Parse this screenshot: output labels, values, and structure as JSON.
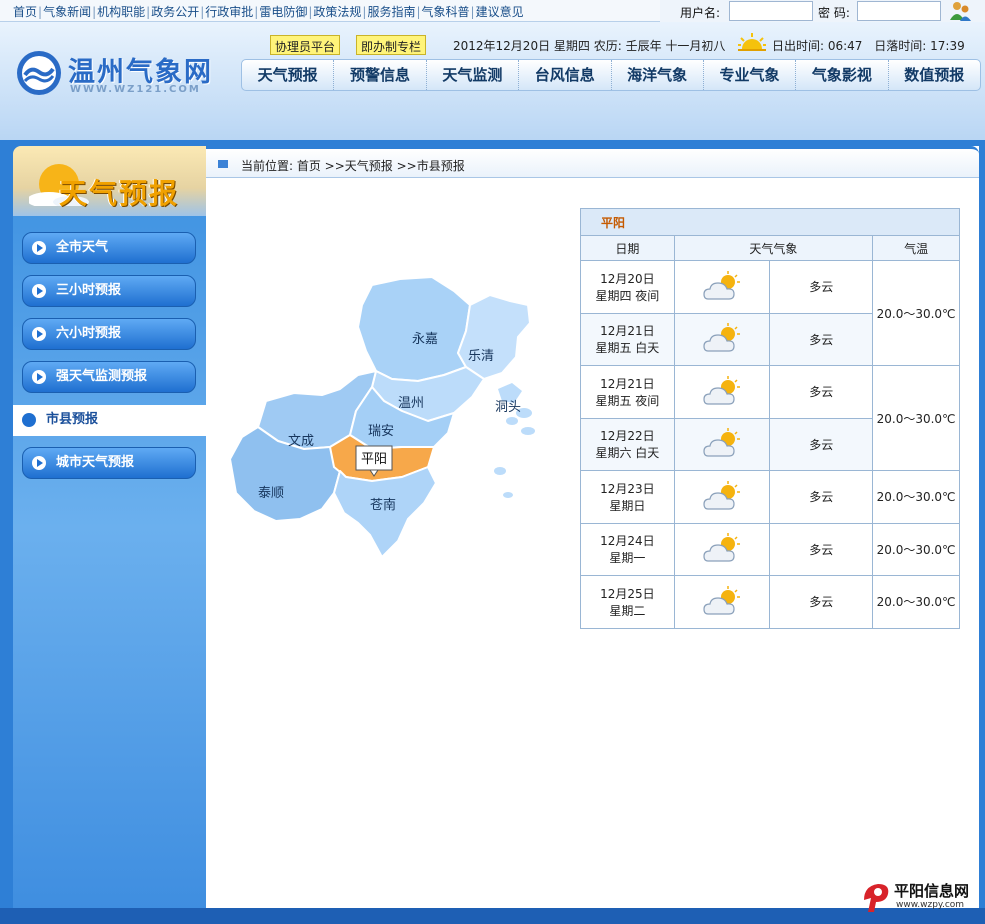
{
  "topnav": {
    "links": [
      "首页",
      "气象新闻",
      "机构职能",
      "政务公开",
      "行政审批",
      "雷电防御",
      "政策法规",
      "服务指南",
      "气象科普",
      "建议意见"
    ]
  },
  "login": {
    "user_label": "用户名:",
    "pass_label": "密 码:"
  },
  "site": {
    "title": "温州气象网",
    "url": "WWW.WZ121.COM"
  },
  "header": {
    "btn1": "协理员平台",
    "btn2": "即办制专栏",
    "date": "2012年12月20日 星期四 农历: 壬辰年 十一月初八",
    "sunrise": "日出时间: 06:47",
    "sunset": "日落时间: 17:39"
  },
  "mainnav": [
    "天气预报",
    "预警信息",
    "天气监测",
    "台风信息",
    "海洋气象",
    "专业气象",
    "气象影视",
    "数值预报"
  ],
  "sidebar": {
    "title": "天气预报",
    "items": [
      "全市天气",
      "三小时预报",
      "六小时预报",
      "强天气监测预报",
      "市县预报",
      "城市天气预报"
    ],
    "active_index": 4
  },
  "breadcrumb": {
    "text": "当前位置:  首页  >>天气预报  >>市县预报"
  },
  "map": {
    "labels": [
      "永嘉",
      "乐清",
      "洞头",
      "温州",
      "瑞安",
      "文成",
      "泰顺",
      "苍南"
    ],
    "highlight": "平阳"
  },
  "forecast": {
    "city": "平阳",
    "headers": {
      "date": "日期",
      "weather": "天气气象",
      "temp": "气温"
    },
    "icon": "partly-cloudy-icon",
    "rows": [
      {
        "date": "12月20日",
        "day": "星期四 夜间",
        "weather": "多云"
      },
      {
        "date": "12月21日",
        "day": "星期五 白天",
        "weather": "多云"
      },
      {
        "date": "12月21日",
        "day": "星期五 夜间",
        "weather": "多云"
      },
      {
        "date": "12月22日",
        "day": "星期六 白天",
        "weather": "多云"
      },
      {
        "date": "12月23日",
        "day": "星期日",
        "weather": "多云"
      },
      {
        "date": "12月24日",
        "day": "星期一",
        "weather": "多云"
      },
      {
        "date": "12月25日",
        "day": "星期二",
        "weather": "多云"
      }
    ],
    "temps": [
      "20.0～30.0℃",
      "20.0～30.0℃",
      "20.0～30.0℃",
      "20.0～30.0℃",
      "20.0～30.0℃"
    ]
  },
  "watermark": {
    "name": "平阳信息网",
    "url": "www.wzpy.com"
  },
  "colors": {
    "brand": "#2a6bc6",
    "sidebar": "#3a8fe0",
    "highlight_region": "#f7a84a"
  }
}
